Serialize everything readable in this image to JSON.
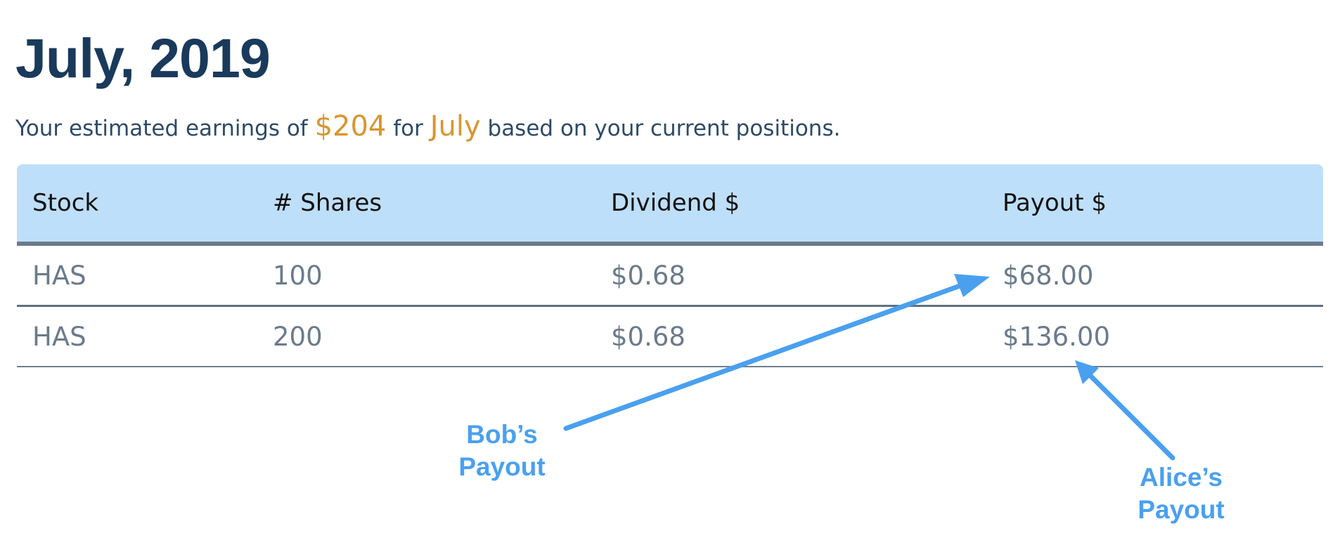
{
  "header": {
    "title": "July, 2019"
  },
  "summary": {
    "prefix": "Your estimated earnings of ",
    "amount": "$204",
    "middle": " for ",
    "month": "July",
    "suffix": " based on your current positions."
  },
  "table": {
    "columns": [
      "Stock",
      "# Shares",
      "Dividend $",
      "Payout $"
    ],
    "rows": [
      [
        "HAS",
        "100",
        "$0.68",
        "$68.00"
      ],
      [
        "HAS",
        "200",
        "$0.68",
        "$136.00"
      ]
    ]
  },
  "annotations": {
    "bob": {
      "line1": "Bob’s",
      "line2": "Payout"
    },
    "alice": {
      "line1": "Alice’s",
      "line2": "Payout"
    }
  },
  "colors": {
    "title": "#1a3a5c",
    "highlight": "#d8962f",
    "header_bg": "#bedff9",
    "cell_text": "#6a7b8c",
    "annotation": "#4aa0ef"
  }
}
